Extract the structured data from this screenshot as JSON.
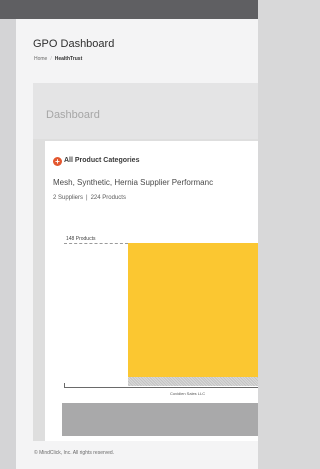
{
  "app": {
    "title": "GPO Dashboard"
  },
  "breadcrumb": {
    "home": "Home",
    "separator": "/",
    "current": "HealthTrust"
  },
  "panel": {
    "title": "Dashboard"
  },
  "card": {
    "category_icon": "plus-circle-icon",
    "category_icon_glyph": "+",
    "category_title": "All Product Categories",
    "subtitle": "Mesh, Synthetic, Hernia Supplier Performanc",
    "suppliers": "2 Suppliers",
    "meta_separator": "|",
    "products": "224 Products"
  },
  "chart_data": {
    "type": "bar",
    "y_axis_max_label": "148 Products",
    "categories": [
      "Covidien Sales LLC"
    ],
    "values": [
      148
    ],
    "ylim": [
      0,
      148
    ],
    "bar_color": "#fbc731"
  },
  "footer": {
    "copyright": "© MindClick, Inc. All rights reserved."
  },
  "colors": {
    "top_bar": "#5f5f62",
    "accent_icon": "#e2572f",
    "bar": "#fbc731"
  }
}
